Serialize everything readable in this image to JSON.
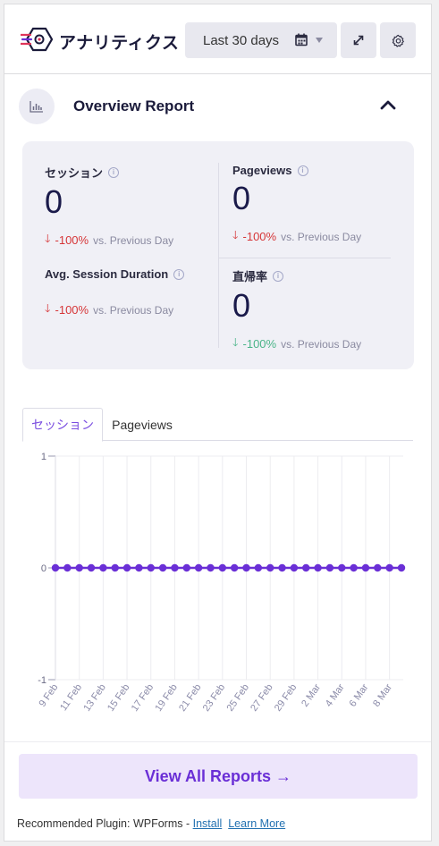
{
  "header": {
    "brand": "アナリティクス",
    "date_range": "Last 30 days",
    "icons": [
      "calendar-icon",
      "expand-icon",
      "gear-icon"
    ]
  },
  "overview": {
    "title": "Overview Report",
    "icon": "bar-chart-icon",
    "stats": [
      {
        "label": "セッション",
        "value": "0",
        "change": "-100%",
        "direction": "down",
        "color": "#d63638",
        "compare": "vs. Previous Day"
      },
      {
        "label": "Pageviews",
        "value": "0",
        "change": "-100%",
        "direction": "down",
        "color": "#d63638",
        "compare": "vs. Previous Day"
      },
      {
        "label": "Avg. Session Duration",
        "value": "",
        "change": "-100%",
        "direction": "down",
        "color": "#d63638",
        "compare": "vs. Previous Day"
      },
      {
        "label": "直帰率",
        "value": "0",
        "change": "-100%",
        "direction": "down",
        "color": "#4ab488",
        "compare": "vs. Previous Day"
      }
    ]
  },
  "tabs": [
    {
      "label": "セッション",
      "active": true
    },
    {
      "label": "Pageviews",
      "active": false
    }
  ],
  "chart_data": {
    "type": "line",
    "x": [
      "9 Feb",
      "10 Feb",
      "11 Feb",
      "12 Feb",
      "13 Feb",
      "14 Feb",
      "15 Feb",
      "16 Feb",
      "17 Feb",
      "18 Feb",
      "19 Feb",
      "20 Feb",
      "21 Feb",
      "22 Feb",
      "23 Feb",
      "24 Feb",
      "25 Feb",
      "26 Feb",
      "27 Feb",
      "28 Feb",
      "29 Feb",
      "1 Mar",
      "2 Mar",
      "3 Mar",
      "4 Mar",
      "5 Mar",
      "6 Mar",
      "7 Mar",
      "8 Mar",
      "9 Mar"
    ],
    "tick_labels": [
      "9 Feb",
      "11 Feb",
      "13 Feb",
      "15 Feb",
      "17 Feb",
      "19 Feb",
      "21 Feb",
      "23 Feb",
      "25 Feb",
      "27 Feb",
      "29 Feb",
      "2 Mar",
      "4 Mar",
      "6 Mar",
      "8 Mar"
    ],
    "series": [
      {
        "values": [
          0,
          0,
          0,
          0,
          0,
          0,
          0,
          0,
          0,
          0,
          0,
          0,
          0,
          0,
          0,
          0,
          0,
          0,
          0,
          0,
          0,
          0,
          0,
          0,
          0,
          0,
          0,
          0,
          0,
          0
        ]
      }
    ],
    "yticks": [
      "1",
      "0",
      "-1"
    ],
    "ylim": [
      -1,
      1
    ],
    "line_color": "#6a2fd6",
    "grid": true
  },
  "footer": {
    "view_all": "View All Reports",
    "arrow": "→",
    "recommended_prefix": "Recommended Plugin: ",
    "plugin": "WPForms",
    "sep": " - ",
    "install": "Install",
    "learn_more": "Learn More"
  }
}
